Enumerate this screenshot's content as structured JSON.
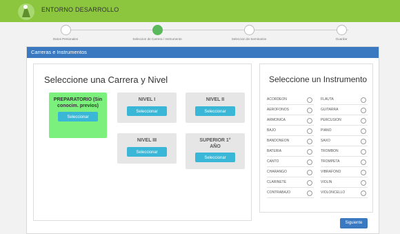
{
  "app": {
    "title": "ENTORNO DESARROLLO"
  },
  "colors": {
    "topbar": "#8cc63f",
    "header": "#3a79c0",
    "selected_card": "#7cf07c",
    "button": "#3ab7d6",
    "step_active": "#5cb85c"
  },
  "steps": [
    {
      "label": "Datos Personales",
      "active": false
    },
    {
      "label": "Seleccion de Carrera / Instrumento",
      "active": true
    },
    {
      "label": "Seleccion de Seminarios",
      "active": false
    },
    {
      "label": "Guardar",
      "active": false
    }
  ],
  "panel": {
    "header": "Carreras e Instrumentos"
  },
  "careers": {
    "title": "Seleccione una Carrera y Nivel",
    "button_label": "Seleccionar",
    "items": [
      {
        "title": "PREPARATORIO (Sin conocim. previos)",
        "selected": true
      },
      {
        "title": "NIVEL I",
        "selected": false
      },
      {
        "title": "NIVEL II",
        "selected": false
      },
      {
        "title": "NIVEL III",
        "selected": false
      },
      {
        "title": "SUPERIOR 1° AÑO",
        "selected": false
      }
    ]
  },
  "instruments": {
    "title": "Seleccione un Instrumento",
    "left": [
      "ACORDEON",
      "AEROFONOS",
      "ARMONICA",
      "BAJO",
      "BANDONEON",
      "BATERIA",
      "CANTO",
      "CHARANGO",
      "CLARINETE",
      "CONTRABAJO"
    ],
    "right": [
      "FLAUTA",
      "GUITARRA",
      "PERCUSION",
      "PIANO",
      "SAXO",
      "TROMBON",
      "TROMPETA",
      "VIBRAFONO",
      "VIOLIN",
      "VIOLONCELLO"
    ]
  },
  "footer": {
    "next_label": "Siguiente"
  }
}
